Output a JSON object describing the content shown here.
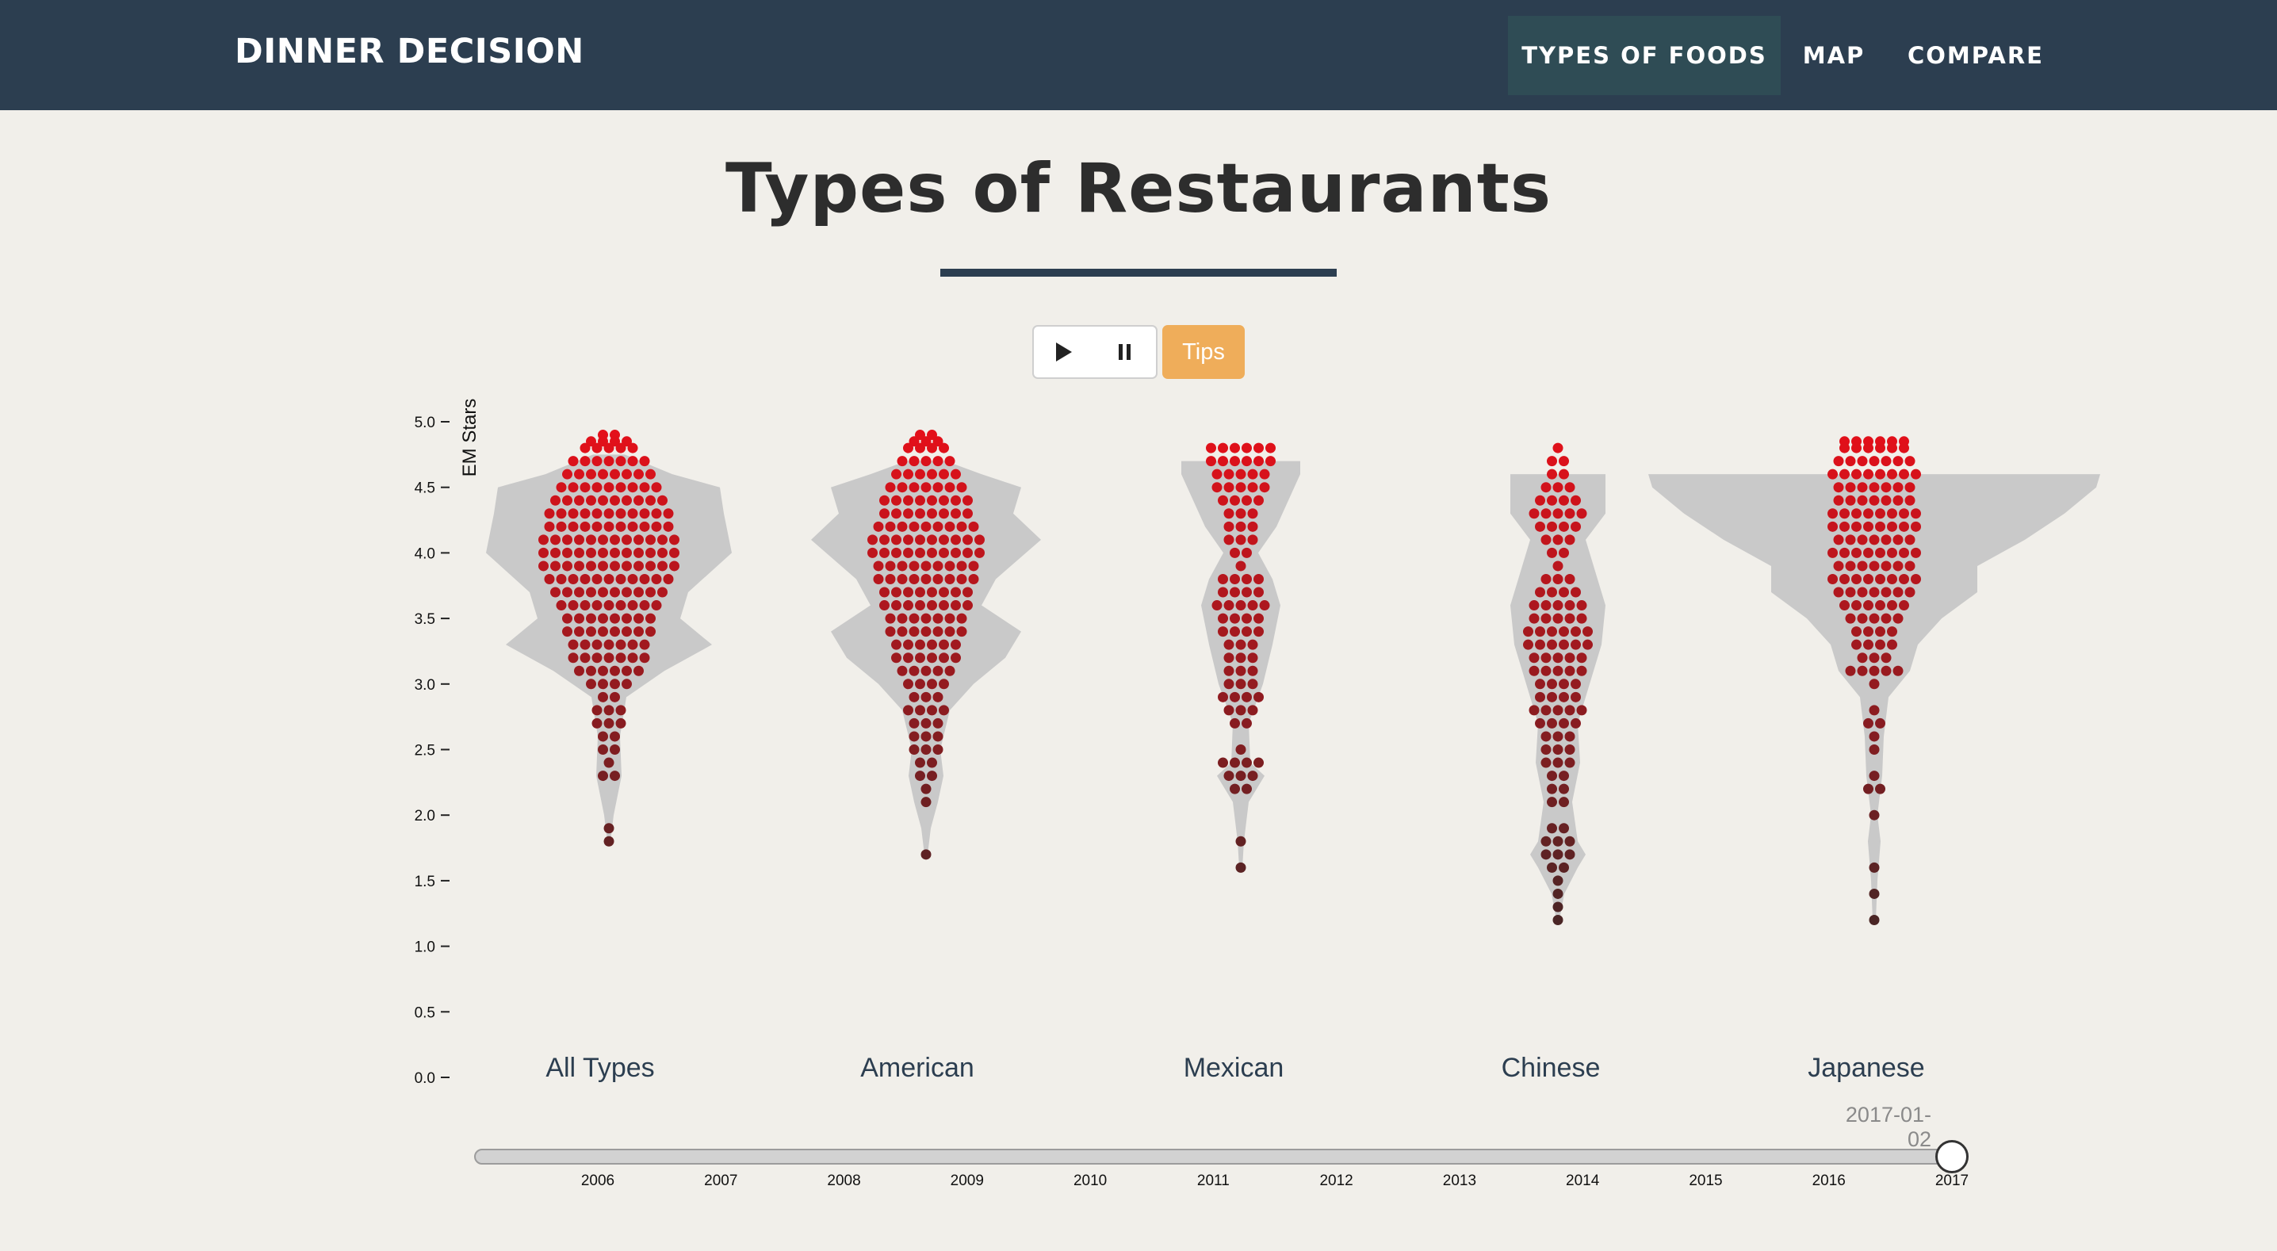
{
  "nav": {
    "brand": "DINNER DECISION",
    "items": [
      {
        "label": "TYPES OF FOODS",
        "active": true
      },
      {
        "label": "MAP",
        "active": false
      },
      {
        "label": "COMPARE",
        "active": false
      }
    ]
  },
  "page": {
    "title": "Types of Restaurants"
  },
  "controls": {
    "play_icon": "play-icon",
    "pause_icon": "pause-icon",
    "tips_label": "Tips",
    "tips_color": "#efad5a"
  },
  "slider": {
    "current_date": "2017-01-02",
    "ticks": [
      "2006",
      "2007",
      "2008",
      "2009",
      "2010",
      "2011",
      "2012",
      "2013",
      "2014",
      "2015",
      "2016",
      "2017"
    ],
    "position_fraction": 1.0
  },
  "colors": {
    "nav_bg": "#2c3e50",
    "page_bg": "#f1efea",
    "violin": "#c9c9c9",
    "dot_high": "#e3101a",
    "dot_low": "#4a2525"
  },
  "chart_data": {
    "type": "violin-beeswarm",
    "ylabel": "EM Stars",
    "ylim": [
      0,
      5
    ],
    "yticks": [
      "0.0",
      "0.5",
      "1.0",
      "1.5",
      "2.0",
      "2.5",
      "3.0",
      "3.5",
      "4.0",
      "4.5",
      "5.0"
    ],
    "categories": [
      "All Types",
      "American",
      "Mexican",
      "Chinese",
      "Japanese"
    ],
    "series": [
      {
        "name": "All Types",
        "violin": [
          [
            1.8,
            2
          ],
          [
            2.0,
            6
          ],
          [
            2.3,
            16
          ],
          [
            2.6,
            14
          ],
          [
            2.9,
            22
          ],
          [
            3.1,
            70
          ],
          [
            3.3,
            130
          ],
          [
            3.5,
            90
          ],
          [
            3.7,
            100
          ],
          [
            4.0,
            155
          ],
          [
            4.3,
            145
          ],
          [
            4.5,
            140
          ],
          [
            4.6,
            80
          ],
          [
            4.75,
            20
          ]
        ],
        "dots": [
          [
            4.9,
            2
          ],
          [
            4.85,
            4
          ],
          [
            4.8,
            5
          ],
          [
            4.7,
            7
          ],
          [
            4.6,
            8
          ],
          [
            4.5,
            9
          ],
          [
            4.4,
            10
          ],
          [
            4.3,
            11
          ],
          [
            4.2,
            11
          ],
          [
            4.1,
            12
          ],
          [
            4.0,
            12
          ],
          [
            3.9,
            12
          ],
          [
            3.8,
            11
          ],
          [
            3.7,
            10
          ],
          [
            3.6,
            9
          ],
          [
            3.5,
            8
          ],
          [
            3.4,
            8
          ],
          [
            3.3,
            7
          ],
          [
            3.2,
            7
          ],
          [
            3.1,
            6
          ],
          [
            3.0,
            4
          ],
          [
            2.9,
            2
          ],
          [
            2.8,
            3
          ],
          [
            2.7,
            3
          ],
          [
            2.6,
            2
          ],
          [
            2.5,
            2
          ],
          [
            2.4,
            1
          ],
          [
            2.3,
            2
          ],
          [
            1.9,
            1
          ],
          [
            1.8,
            1
          ]
        ]
      },
      {
        "name": "American",
        "violin": [
          [
            1.7,
            2
          ],
          [
            1.9,
            6
          ],
          [
            2.1,
            15
          ],
          [
            2.3,
            22
          ],
          [
            2.5,
            18
          ],
          [
            2.8,
            30
          ],
          [
            3.0,
            60
          ],
          [
            3.2,
            100
          ],
          [
            3.4,
            120
          ],
          [
            3.6,
            70
          ],
          [
            3.8,
            88
          ],
          [
            4.1,
            145
          ],
          [
            4.3,
            110
          ],
          [
            4.5,
            120
          ],
          [
            4.6,
            70
          ],
          [
            4.7,
            25
          ]
        ],
        "dots": [
          [
            4.9,
            2
          ],
          [
            4.85,
            3
          ],
          [
            4.8,
            4
          ],
          [
            4.7,
            5
          ],
          [
            4.6,
            6
          ],
          [
            4.5,
            7
          ],
          [
            4.4,
            8
          ],
          [
            4.3,
            8
          ],
          [
            4.2,
            9
          ],
          [
            4.1,
            10
          ],
          [
            4.0,
            10
          ],
          [
            3.9,
            9
          ],
          [
            3.8,
            9
          ],
          [
            3.7,
            8
          ],
          [
            3.6,
            8
          ],
          [
            3.5,
            7
          ],
          [
            3.4,
            7
          ],
          [
            3.3,
            6
          ],
          [
            3.2,
            6
          ],
          [
            3.1,
            5
          ],
          [
            3.0,
            4
          ],
          [
            2.9,
            3
          ],
          [
            2.8,
            4
          ],
          [
            2.7,
            3
          ],
          [
            2.6,
            3
          ],
          [
            2.5,
            3
          ],
          [
            2.4,
            2
          ],
          [
            2.3,
            2
          ],
          [
            2.2,
            1
          ],
          [
            2.1,
            1
          ],
          [
            1.7,
            1
          ]
        ]
      },
      {
        "name": "Mexican",
        "violin": [
          [
            1.6,
            2
          ],
          [
            1.8,
            4
          ],
          [
            2.1,
            10
          ],
          [
            2.3,
            30
          ],
          [
            2.4,
            12
          ],
          [
            2.7,
            10
          ],
          [
            3.0,
            28
          ],
          [
            3.3,
            40
          ],
          [
            3.6,
            50
          ],
          [
            3.8,
            40
          ],
          [
            4.0,
            22
          ],
          [
            4.2,
            45
          ],
          [
            4.4,
            60
          ],
          [
            4.6,
            75
          ],
          [
            4.7,
            75
          ]
        ],
        "dots": [
          [
            4.8,
            6
          ],
          [
            4.7,
            6
          ],
          [
            4.6,
            5
          ],
          [
            4.5,
            5
          ],
          [
            4.4,
            4
          ],
          [
            4.3,
            3
          ],
          [
            4.2,
            3
          ],
          [
            4.1,
            3
          ],
          [
            4.0,
            2
          ],
          [
            3.9,
            1
          ],
          [
            3.8,
            4
          ],
          [
            3.7,
            4
          ],
          [
            3.6,
            5
          ],
          [
            3.5,
            4
          ],
          [
            3.4,
            4
          ],
          [
            3.3,
            3
          ],
          [
            3.2,
            3
          ],
          [
            3.1,
            3
          ],
          [
            3.0,
            3
          ],
          [
            2.9,
            4
          ],
          [
            2.8,
            3
          ],
          [
            2.7,
            2
          ],
          [
            2.5,
            1
          ],
          [
            2.4,
            4
          ],
          [
            2.3,
            3
          ],
          [
            2.2,
            2
          ],
          [
            1.8,
            1
          ],
          [
            1.6,
            1
          ]
        ]
      },
      {
        "name": "Chinese",
        "violin": [
          [
            1.2,
            2
          ],
          [
            1.4,
            8
          ],
          [
            1.6,
            25
          ],
          [
            1.7,
            35
          ],
          [
            1.8,
            25
          ],
          [
            2.1,
            18
          ],
          [
            2.4,
            28
          ],
          [
            2.7,
            25
          ],
          [
            3.0,
            40
          ],
          [
            3.3,
            55
          ],
          [
            3.6,
            60
          ],
          [
            3.8,
            50
          ],
          [
            4.1,
            35
          ],
          [
            4.3,
            60
          ],
          [
            4.5,
            60
          ],
          [
            4.6,
            60
          ]
        ],
        "dots": [
          [
            4.8,
            1
          ],
          [
            4.7,
            2
          ],
          [
            4.6,
            2
          ],
          [
            4.5,
            3
          ],
          [
            4.4,
            4
          ],
          [
            4.3,
            5
          ],
          [
            4.2,
            4
          ],
          [
            4.1,
            3
          ],
          [
            4.0,
            2
          ],
          [
            3.9,
            1
          ],
          [
            3.8,
            3
          ],
          [
            3.7,
            4
          ],
          [
            3.6,
            5
          ],
          [
            3.5,
            5
          ],
          [
            3.4,
            6
          ],
          [
            3.3,
            6
          ],
          [
            3.2,
            5
          ],
          [
            3.1,
            5
          ],
          [
            3.0,
            4
          ],
          [
            2.9,
            4
          ],
          [
            2.8,
            5
          ],
          [
            2.7,
            4
          ],
          [
            2.6,
            3
          ],
          [
            2.5,
            3
          ],
          [
            2.4,
            3
          ],
          [
            2.3,
            2
          ],
          [
            2.2,
            2
          ],
          [
            2.1,
            2
          ],
          [
            1.9,
            2
          ],
          [
            1.8,
            3
          ],
          [
            1.7,
            3
          ],
          [
            1.6,
            2
          ],
          [
            1.5,
            1
          ],
          [
            1.4,
            1
          ],
          [
            1.3,
            1
          ],
          [
            1.2,
            1
          ]
        ]
      },
      {
        "name": "Japanese",
        "violin": [
          [
            1.2,
            2
          ],
          [
            1.5,
            4
          ],
          [
            1.8,
            8
          ],
          [
            2.0,
            4
          ],
          [
            2.3,
            10
          ],
          [
            2.6,
            12
          ],
          [
            2.9,
            18
          ],
          [
            3.1,
            45
          ],
          [
            3.3,
            55
          ],
          [
            3.5,
            85
          ],
          [
            3.7,
            130
          ],
          [
            3.9,
            130
          ],
          [
            4.1,
            190
          ],
          [
            4.3,
            240
          ],
          [
            4.5,
            280
          ],
          [
            4.6,
            285
          ]
        ],
        "dots": [
          [
            4.85,
            6
          ],
          [
            4.8,
            6
          ],
          [
            4.7,
            7
          ],
          [
            4.6,
            8
          ],
          [
            4.5,
            7
          ],
          [
            4.4,
            7
          ],
          [
            4.3,
            8
          ],
          [
            4.2,
            8
          ],
          [
            4.1,
            7
          ],
          [
            4.0,
            8
          ],
          [
            3.9,
            7
          ],
          [
            3.8,
            8
          ],
          [
            3.7,
            7
          ],
          [
            3.6,
            6
          ],
          [
            3.5,
            5
          ],
          [
            3.4,
            4
          ],
          [
            3.3,
            4
          ],
          [
            3.2,
            3
          ],
          [
            3.1,
            5
          ],
          [
            3.0,
            1
          ],
          [
            2.8,
            1
          ],
          [
            2.7,
            2
          ],
          [
            2.6,
            1
          ],
          [
            2.5,
            1
          ],
          [
            2.3,
            1
          ],
          [
            2.2,
            2
          ],
          [
            2.0,
            1
          ],
          [
            1.6,
            1
          ],
          [
            1.4,
            1
          ],
          [
            1.2,
            1
          ]
        ]
      }
    ]
  }
}
